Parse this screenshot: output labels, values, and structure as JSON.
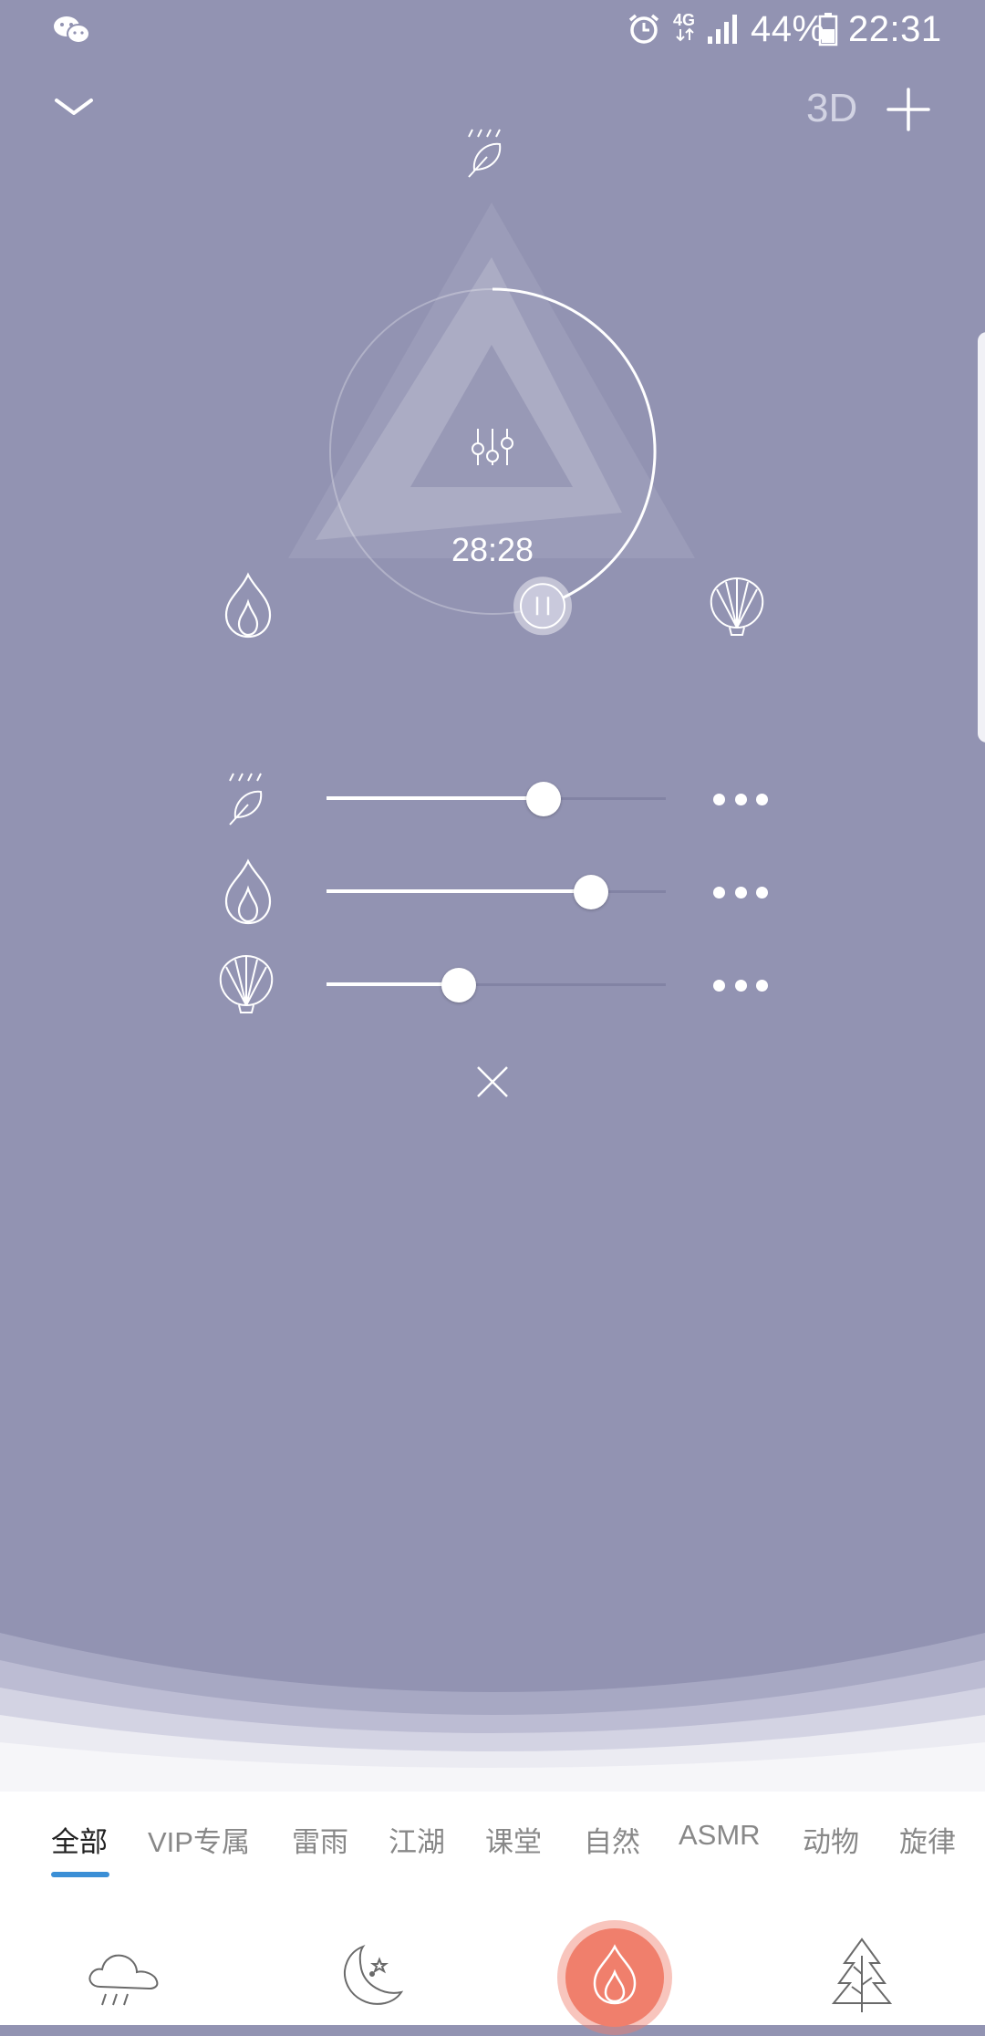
{
  "status_bar": {
    "time": "22:31",
    "battery": "44%",
    "network": "4G",
    "icons": [
      "wechat-icon",
      "alarm-icon",
      "signal-icon",
      "battery-icon"
    ]
  },
  "header": {
    "collapse_icon": "chevron-down-icon",
    "label_3d": "3D",
    "add_icon": "plus-icon"
  },
  "player": {
    "timer": "28:28",
    "progress_fraction": 0.45,
    "state": "playing",
    "center_icon": "equalizer-icon",
    "sounds": [
      {
        "id": "rain-leaf",
        "icon": "rain-leaf-icon",
        "volume": 0.64
      },
      {
        "id": "fire",
        "icon": "flame-icon",
        "volume": 0.78
      },
      {
        "id": "shell",
        "icon": "shell-icon",
        "volume": 0.39
      }
    ]
  },
  "close_icon": "close-icon",
  "categories": {
    "tabs": [
      "全部",
      "VIP专属",
      "雷雨",
      "江湖",
      "课堂",
      "自然",
      "ASMR",
      "动物",
      "旋律"
    ],
    "active_index": 0
  },
  "bottom_nav": [
    "cloud-rain-icon",
    "moon-star-icon",
    "flame-icon",
    "tree-icon"
  ],
  "colors": {
    "background": "#9293b2",
    "accent_orange": "#f07f6c",
    "tab_underline": "#3b8fd6"
  }
}
